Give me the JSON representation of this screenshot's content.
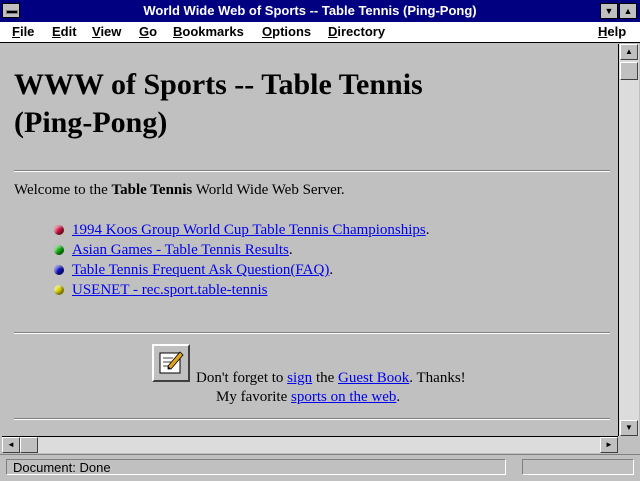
{
  "window": {
    "title": "World Wide Web of Sports -- Table Tennis (Ping-Pong)",
    "minimize_glyph": "▼",
    "maximize_glyph": "▲"
  },
  "menu": {
    "items": [
      {
        "label": "File",
        "key": "F",
        "rest": "ile"
      },
      {
        "label": "Edit",
        "key": "E",
        "rest": "dit"
      },
      {
        "label": "View",
        "key": "V",
        "rest": "iew"
      },
      {
        "label": "Go",
        "key": "G",
        "rest": "o"
      },
      {
        "label": "Bookmarks",
        "key": "B",
        "rest": "ookmarks"
      },
      {
        "label": "Options",
        "key": "O",
        "rest": "ptions"
      },
      {
        "label": "Directory",
        "key": "D",
        "rest": "irectory"
      },
      {
        "label": "Help",
        "key": "H",
        "rest": "elp"
      }
    ]
  },
  "page": {
    "heading_line1": "WWW of Sports -- Table Tennis",
    "heading_line2": "(Ping-Pong)",
    "welcome_pre": "Welcome to the ",
    "welcome_bold": "Table Tennis",
    "welcome_post": " World Wide Web Server.",
    "links": [
      {
        "text": "1994 Koos Group World Cup Table Tennis Championships",
        "suffix": ".",
        "bullet_color": "#d01040"
      },
      {
        "text": "Asian Games - Table Tennis Results",
        "suffix": ".",
        "bullet_color": "#10b010"
      },
      {
        "text": "Table Tennis Frequent Ask Question(FAQ)",
        "suffix": ".",
        "bullet_color": "#1010c0"
      },
      {
        "text": "USENET - rec.sport.table-tennis",
        "suffix": "",
        "bullet_color": "#d8d000"
      }
    ],
    "guest": {
      "pre": "Don't forget to ",
      "sign_link": "sign",
      "mid": " the ",
      "book_link": "Guest Book",
      "post": ". Thanks!"
    },
    "favorite": {
      "pre": "My favorite ",
      "link": "sports on the web",
      "post": "."
    }
  },
  "status": {
    "text": "Document: Done"
  },
  "colors": {
    "link": "#0000ee",
    "titlebar": "#000080"
  }
}
